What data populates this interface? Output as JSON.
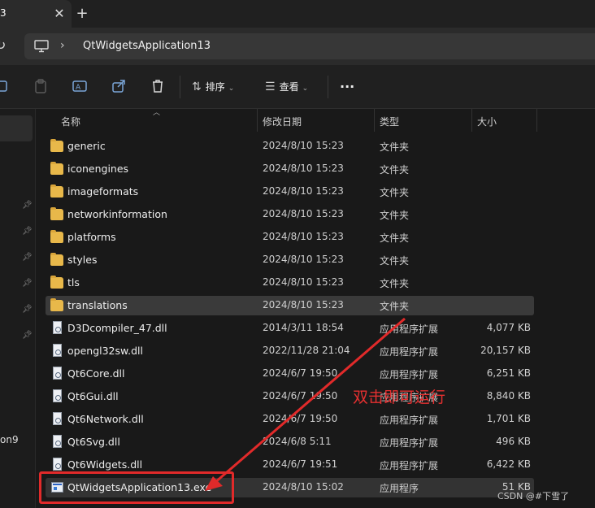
{
  "tab": {
    "title": "3",
    "close_glyph": "✕",
    "new_tab_glyph": "+"
  },
  "address": {
    "breadcrumb": "QtWidgetsApplication13",
    "separator": "›",
    "refresh_glyph": "↻"
  },
  "toolbar": {
    "sort_label": "排序",
    "view_label": "查看",
    "more_glyph": "···"
  },
  "columns": {
    "name": "名称",
    "date": "修改日期",
    "type": "类型",
    "size": "大小"
  },
  "files": [
    {
      "name": "generic",
      "date": "2024/8/10 15:23",
      "type": "文件夹",
      "size": "",
      "icon": "folder-icon"
    },
    {
      "name": "iconengines",
      "date": "2024/8/10 15:23",
      "type": "文件夹",
      "size": "",
      "icon": "folder-icon"
    },
    {
      "name": "imageformats",
      "date": "2024/8/10 15:23",
      "type": "文件夹",
      "size": "",
      "icon": "folder-icon"
    },
    {
      "name": "networkinformation",
      "date": "2024/8/10 15:23",
      "type": "文件夹",
      "size": "",
      "icon": "folder-icon"
    },
    {
      "name": "platforms",
      "date": "2024/8/10 15:23",
      "type": "文件夹",
      "size": "",
      "icon": "folder-icon"
    },
    {
      "name": "styles",
      "date": "2024/8/10 15:23",
      "type": "文件夹",
      "size": "",
      "icon": "folder-icon"
    },
    {
      "name": "tls",
      "date": "2024/8/10 15:23",
      "type": "文件夹",
      "size": "",
      "icon": "folder-icon"
    },
    {
      "name": "translations",
      "date": "2024/8/10 15:23",
      "type": "文件夹",
      "size": "",
      "icon": "folder-icon"
    },
    {
      "name": "D3Dcompiler_47.dll",
      "date": "2014/3/11 18:54",
      "type": "应用程序扩展",
      "size": "4,077 KB",
      "icon": "dll-icon"
    },
    {
      "name": "opengl32sw.dll",
      "date": "2022/11/28 21:04",
      "type": "应用程序扩展",
      "size": "20,157 KB",
      "icon": "dll-icon"
    },
    {
      "name": "Qt6Core.dll",
      "date": "2024/6/7 19:50",
      "type": "应用程序扩展",
      "size": "6,251 KB",
      "icon": "dll-icon"
    },
    {
      "name": "Qt6Gui.dll",
      "date": "2024/6/7 19:50",
      "type": "应用程序扩展",
      "size": "8,840 KB",
      "icon": "dll-icon"
    },
    {
      "name": "Qt6Network.dll",
      "date": "2024/6/7 19:50",
      "type": "应用程序扩展",
      "size": "1,701 KB",
      "icon": "dll-icon"
    },
    {
      "name": "Qt6Svg.dll",
      "date": "2024/6/8 5:11",
      "type": "应用程序扩展",
      "size": "496 KB",
      "icon": "dll-icon"
    },
    {
      "name": "Qt6Widgets.dll",
      "date": "2024/6/7 19:51",
      "type": "应用程序扩展",
      "size": "6,422 KB",
      "icon": "dll-icon"
    },
    {
      "name": "QtWidgetsApplication13.exe",
      "date": "2024/8/10 15:02",
      "type": "应用程序",
      "size": "51 KB",
      "icon": "exe-icon"
    }
  ],
  "nav_fragment": "on9",
  "annotation": {
    "text": "双击即可运行",
    "color": "#e53030"
  },
  "watermark": "CSDN @#下雪了",
  "colors": {
    "folder": "#e8b84a",
    "annotation_red": "#e12a2a",
    "background": "#191919"
  }
}
